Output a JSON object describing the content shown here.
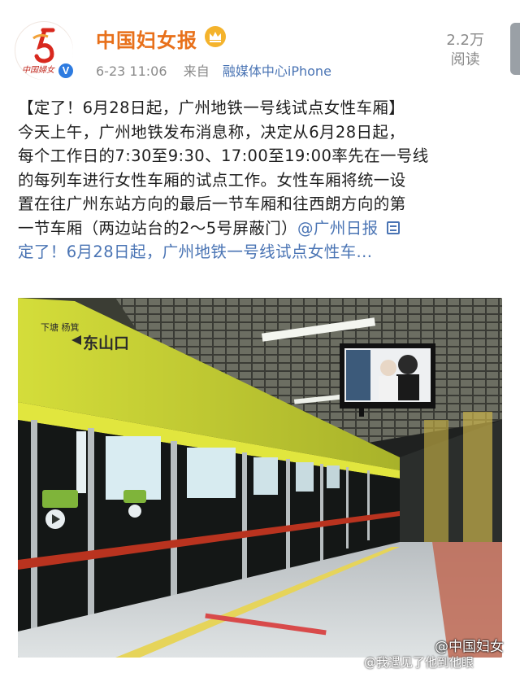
{
  "author": {
    "name": "中国妇女报",
    "avatar_text": "中国婦女",
    "verified_icon": "verified-v-icon",
    "badge_icon": "crown-badge-icon"
  },
  "post_meta": {
    "time": "6-23 11:06",
    "source_prefix": "来自",
    "source": "融媒体中心iPhone"
  },
  "stats": {
    "views_count": "2.2万",
    "views_label": "阅读"
  },
  "content": {
    "line1": "【定了！6月28日起，广州地铁一号线试点女性车厢】",
    "line2": "今天上午，广州地铁发布消息称，决定从6月28日起，",
    "line3": "每个工作日的7:30至9:30、17:00至19:00率先在一号线",
    "line4": "的每列车进行女性车厢的试点工作。女性车厢将统一设",
    "line5": "置在往广州东站方向的最后一节车厢和往西朗方向的第",
    "line6": "一节车厢（两边站台的2～5号屏蔽门）",
    "mention": "@广州日报",
    "link_icon": "article-link-icon",
    "link_title": "定了！6月28日起，广州地铁一号线试点女性车..."
  },
  "photo": {
    "station_sign_small": "下塘 杨箕",
    "station_sign_main": "东山口"
  },
  "watermarks": {
    "primary": "@中国妇女",
    "secondary": "@我遇见了他到他眼"
  },
  "colors": {
    "author_name": "#e8701a",
    "link": "#4a74b4",
    "meta": "#8a8a8a",
    "verified": "#2d7be0",
    "platform_yellow": "#c9d23a"
  }
}
